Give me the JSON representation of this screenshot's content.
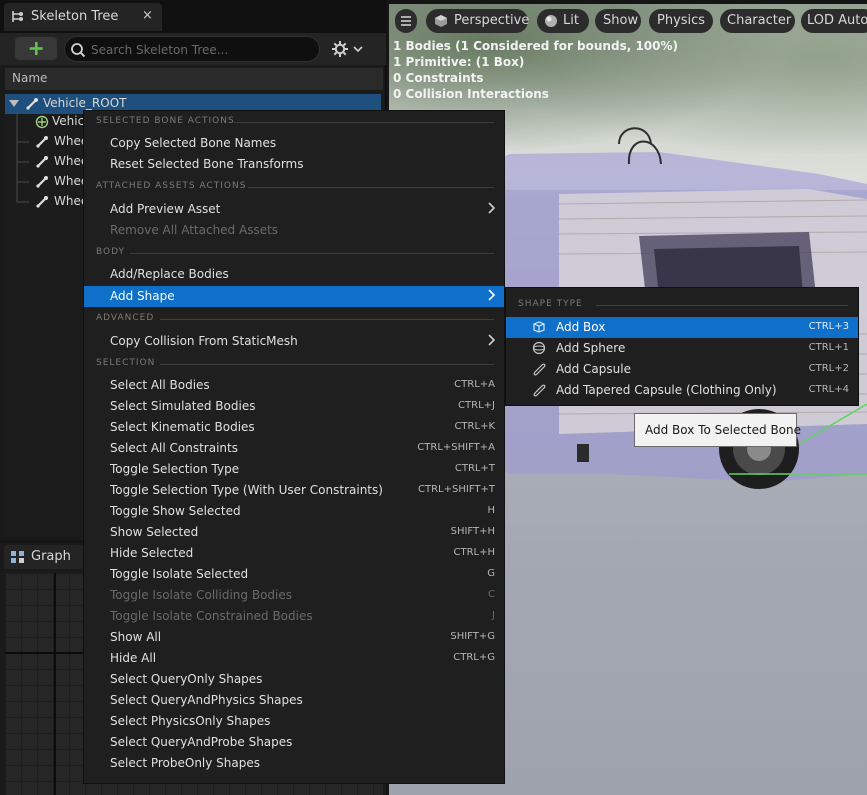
{
  "skeleton_tree": {
    "tab_title": "Skeleton Tree",
    "close_glyph": "×",
    "search_placeholder": "Search Skeleton Tree...",
    "column_name": "Name",
    "rows": [
      {
        "label": "Vehicle_ROOT",
        "icon": "bone-icon"
      },
      {
        "label": "Vehic",
        "icon": "socket-icon"
      },
      {
        "label": "Whee",
        "icon": "bone-icon"
      },
      {
        "label": "Whee",
        "icon": "bone-icon"
      },
      {
        "label": "Whee",
        "icon": "bone-icon"
      },
      {
        "label": "Whee",
        "icon": "bone-icon"
      }
    ]
  },
  "graph": {
    "tab_title": "Graph"
  },
  "viewport": {
    "buttons": [
      "Perspective",
      "Lit",
      "Show",
      "Physics",
      "Character",
      "LOD Auto"
    ],
    "stats": [
      "1 Bodies (1 Considered for bounds, 100%)",
      "1 Primitive: (1 Box)",
      "0 Constraints",
      "0 Collision Interactions"
    ]
  },
  "context_menu": {
    "sections": {
      "selected_bone": "SELECTED BONE ACTIONS",
      "attached_assets": "ATTACHED ASSETS ACTIONS",
      "body": "BODY",
      "advanced": "ADVANCED",
      "selection": "SELECTION"
    },
    "bone_items": [
      {
        "label": "Copy Selected Bone Names"
      },
      {
        "label": "Reset Selected Bone Transforms"
      }
    ],
    "asset_items": [
      {
        "label": "Add Preview Asset",
        "submenu": true
      },
      {
        "label": "Remove All Attached Assets",
        "disabled": true
      }
    ],
    "body_items": [
      {
        "label": "Add/Replace Bodies"
      },
      {
        "label": "Add Shape",
        "submenu": true,
        "active": true
      }
    ],
    "advanced_items": [
      {
        "label": "Copy Collision From StaticMesh",
        "submenu": true
      }
    ],
    "selection_items": [
      {
        "label": "Select All Bodies",
        "shortcut": "CTRL+A"
      },
      {
        "label": "Select Simulated Bodies",
        "shortcut": "CTRL+J"
      },
      {
        "label": "Select Kinematic Bodies",
        "shortcut": "CTRL+K"
      },
      {
        "label": "Select All Constraints",
        "shortcut": "CTRL+SHIFT+A"
      },
      {
        "label": "Toggle Selection Type",
        "shortcut": "CTRL+T"
      },
      {
        "label": "Toggle Selection Type (With User Constraints)",
        "shortcut": "CTRL+SHIFT+T"
      },
      {
        "label": "Toggle Show Selected",
        "shortcut": "H"
      },
      {
        "label": "Show Selected",
        "shortcut": "SHIFT+H"
      },
      {
        "label": "Hide Selected",
        "shortcut": "CTRL+H"
      },
      {
        "label": "Toggle Isolate Selected",
        "shortcut": "G"
      },
      {
        "label": "Toggle Isolate Colliding Bodies",
        "shortcut": "C",
        "disabled": true
      },
      {
        "label": "Toggle Isolate Constrained Bodies",
        "shortcut": "J",
        "disabled": true
      },
      {
        "label": "Show All",
        "shortcut": "SHIFT+G"
      },
      {
        "label": "Hide All",
        "shortcut": "CTRL+G"
      },
      {
        "label": "Select QueryOnly Shapes"
      },
      {
        "label": "Select QueryAndPhysics Shapes"
      },
      {
        "label": "Select PhysicsOnly Shapes"
      },
      {
        "label": "Select QueryAndProbe Shapes"
      },
      {
        "label": "Select ProbeOnly Shapes"
      }
    ]
  },
  "submenu": {
    "section": "SHAPE TYPE",
    "items": [
      {
        "label": "Add Box",
        "shortcut": "CTRL+3",
        "active": true,
        "icon": "box-shape-icon"
      },
      {
        "label": "Add Sphere",
        "shortcut": "CTRL+1",
        "icon": "sphere-shape-icon"
      },
      {
        "label": "Add Capsule",
        "shortcut": "CTRL+2",
        "icon": "capsule-shape-icon"
      },
      {
        "label": "Add Tapered Capsule (Clothing Only)",
        "shortcut": "CTRL+4",
        "icon": "tapered-capsule-icon"
      }
    ]
  },
  "tooltip": "Add Box To Selected Bone",
  "colors": {
    "accent": "#0e70c9",
    "add_green": "#62c14a",
    "tree_selection": "#1e4f7d",
    "vehicle_tint": "#9b95d8"
  }
}
